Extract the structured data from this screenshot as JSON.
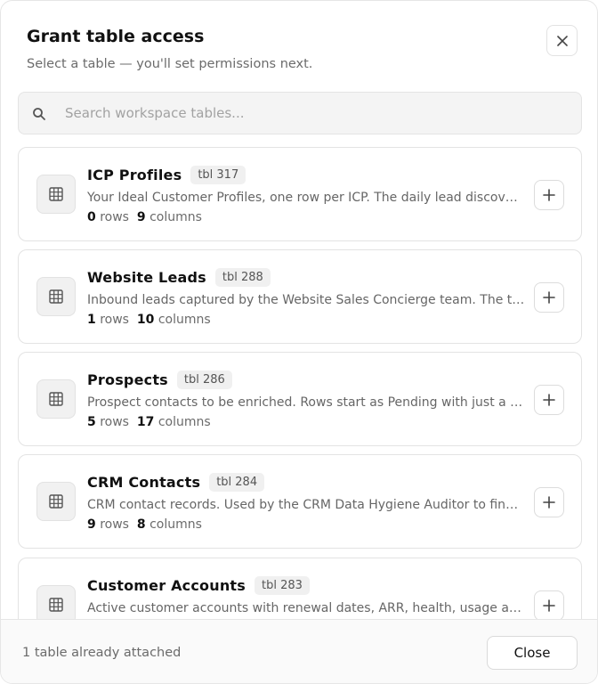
{
  "dialog": {
    "title": "Grant table access",
    "subtitle": "Select a table — you'll set permissions next."
  },
  "search": {
    "placeholder": "Search workspace tables..."
  },
  "tables": [
    {
      "name": "ICP Profiles",
      "badge": "tbl 317",
      "description": "Your Ideal Customer Profiles, one row per ICP. The daily lead discovery agent reads these to find matching leads.",
      "rows": "0",
      "rows_label": "rows",
      "columns": "9",
      "columns_label": "columns"
    },
    {
      "name": "Website Leads",
      "badge": "tbl 288",
      "description": "Inbound leads captured by the Website Sales Concierge team. The team writes a new row for every qualified visitor.",
      "rows": "1",
      "rows_label": "rows",
      "columns": "10",
      "columns_label": "columns"
    },
    {
      "name": "Prospects",
      "badge": "tbl 286",
      "description": "Prospect contacts to be enriched. Rows start as Pending with just a name and company, and the enrichment agent fills the rest.",
      "rows": "5",
      "rows_label": "rows",
      "columns": "17",
      "columns_label": "columns"
    },
    {
      "name": "CRM Contacts",
      "badge": "tbl 284",
      "description": "CRM contact records. Used by the CRM Data Hygiene Auditor to find duplicates and missing fields.",
      "rows": "9",
      "rows_label": "rows",
      "columns": "8",
      "columns_label": "columns"
    },
    {
      "name": "Customer Accounts",
      "badge": "tbl 283",
      "description": "Active customer accounts with renewal dates, ARR, health, usage and owner details for the renewals team.",
      "rows": "",
      "rows_label": "",
      "columns": "",
      "columns_label": ""
    }
  ],
  "footer": {
    "attached_text": "1 table already attached",
    "close_label": "Close"
  },
  "icons": {
    "close": "close-icon",
    "search": "search-icon",
    "table": "table-grid-icon",
    "add": "plus-icon"
  },
  "colors": {
    "background": "#ffffff",
    "border": "#e3e3e3",
    "muted_text": "#6b6b6b",
    "tile_bg": "#f1f1f1"
  }
}
